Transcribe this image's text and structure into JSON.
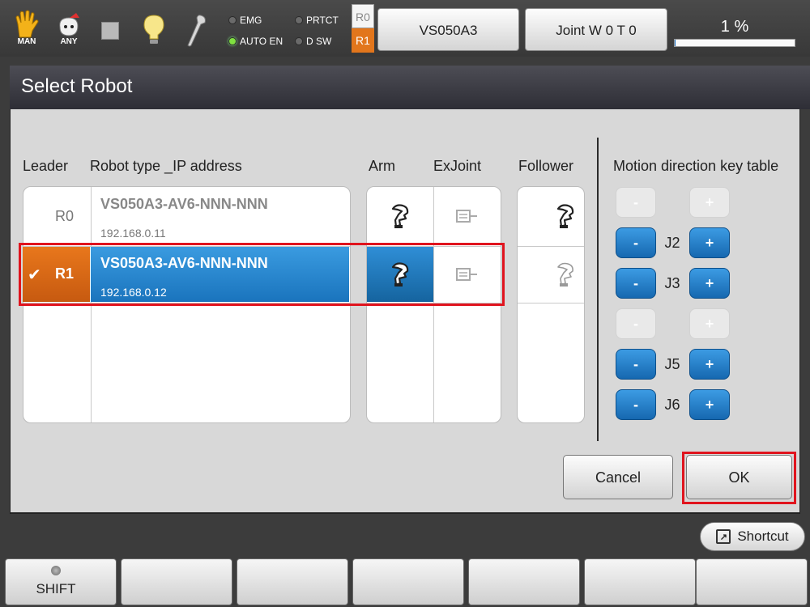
{
  "status_bar": {
    "mode_man_label": "MAN",
    "mode_any_label": "ANY",
    "leds": [
      {
        "label": "EMG",
        "on": false
      },
      {
        "label": "PRTCT",
        "on": false
      },
      {
        "label": "AUTO EN",
        "on": true
      },
      {
        "label": "D SW",
        "on": false
      }
    ],
    "robot_selector": {
      "r0": "R0",
      "r1": "R1"
    },
    "robot_button": "VS050A3",
    "joint_button": "Joint W 0 T 0",
    "speed": {
      "text": "1 %",
      "fraction": 0.01
    }
  },
  "dialog": {
    "title": "Select Robot",
    "headers": {
      "leader": "Leader",
      "robot_type": "Robot type _IP address",
      "arm": "Arm",
      "exjoint": "ExJoint",
      "follower": "Follower",
      "motion_table": "Motion direction key table"
    },
    "robots": [
      {
        "id": "R0",
        "type": "VS050A3-AV6-NNN-NNN",
        "ip": "192.168.0.11",
        "selected": false
      },
      {
        "id": "R1",
        "type": "VS050A3-AV6-NNN-NNN",
        "ip": "192.168.0.12",
        "selected": true
      }
    ],
    "check_mark": "✔",
    "motion_keys": [
      {
        "joint": "",
        "enabled": false,
        "minus": "-",
        "plus": "+"
      },
      {
        "joint": "J2",
        "enabled": true,
        "minus": "-",
        "plus": "+"
      },
      {
        "joint": "J3",
        "enabled": true,
        "minus": "-",
        "plus": "+"
      },
      {
        "joint": "",
        "enabled": false,
        "minus": "-",
        "plus": "+"
      },
      {
        "joint": "J5",
        "enabled": true,
        "minus": "-",
        "plus": "+"
      },
      {
        "joint": "J6",
        "enabled": true,
        "minus": "-",
        "plus": "+"
      }
    ],
    "cancel_label": "Cancel",
    "ok_label": "OK"
  },
  "bottom": {
    "shortcut_label": "Shortcut",
    "shift_label": "SHIFT"
  },
  "colors": {
    "selection_blue": "#1a74bd",
    "leader_orange": "#d0611a",
    "highlight_red": "#e0141e"
  }
}
